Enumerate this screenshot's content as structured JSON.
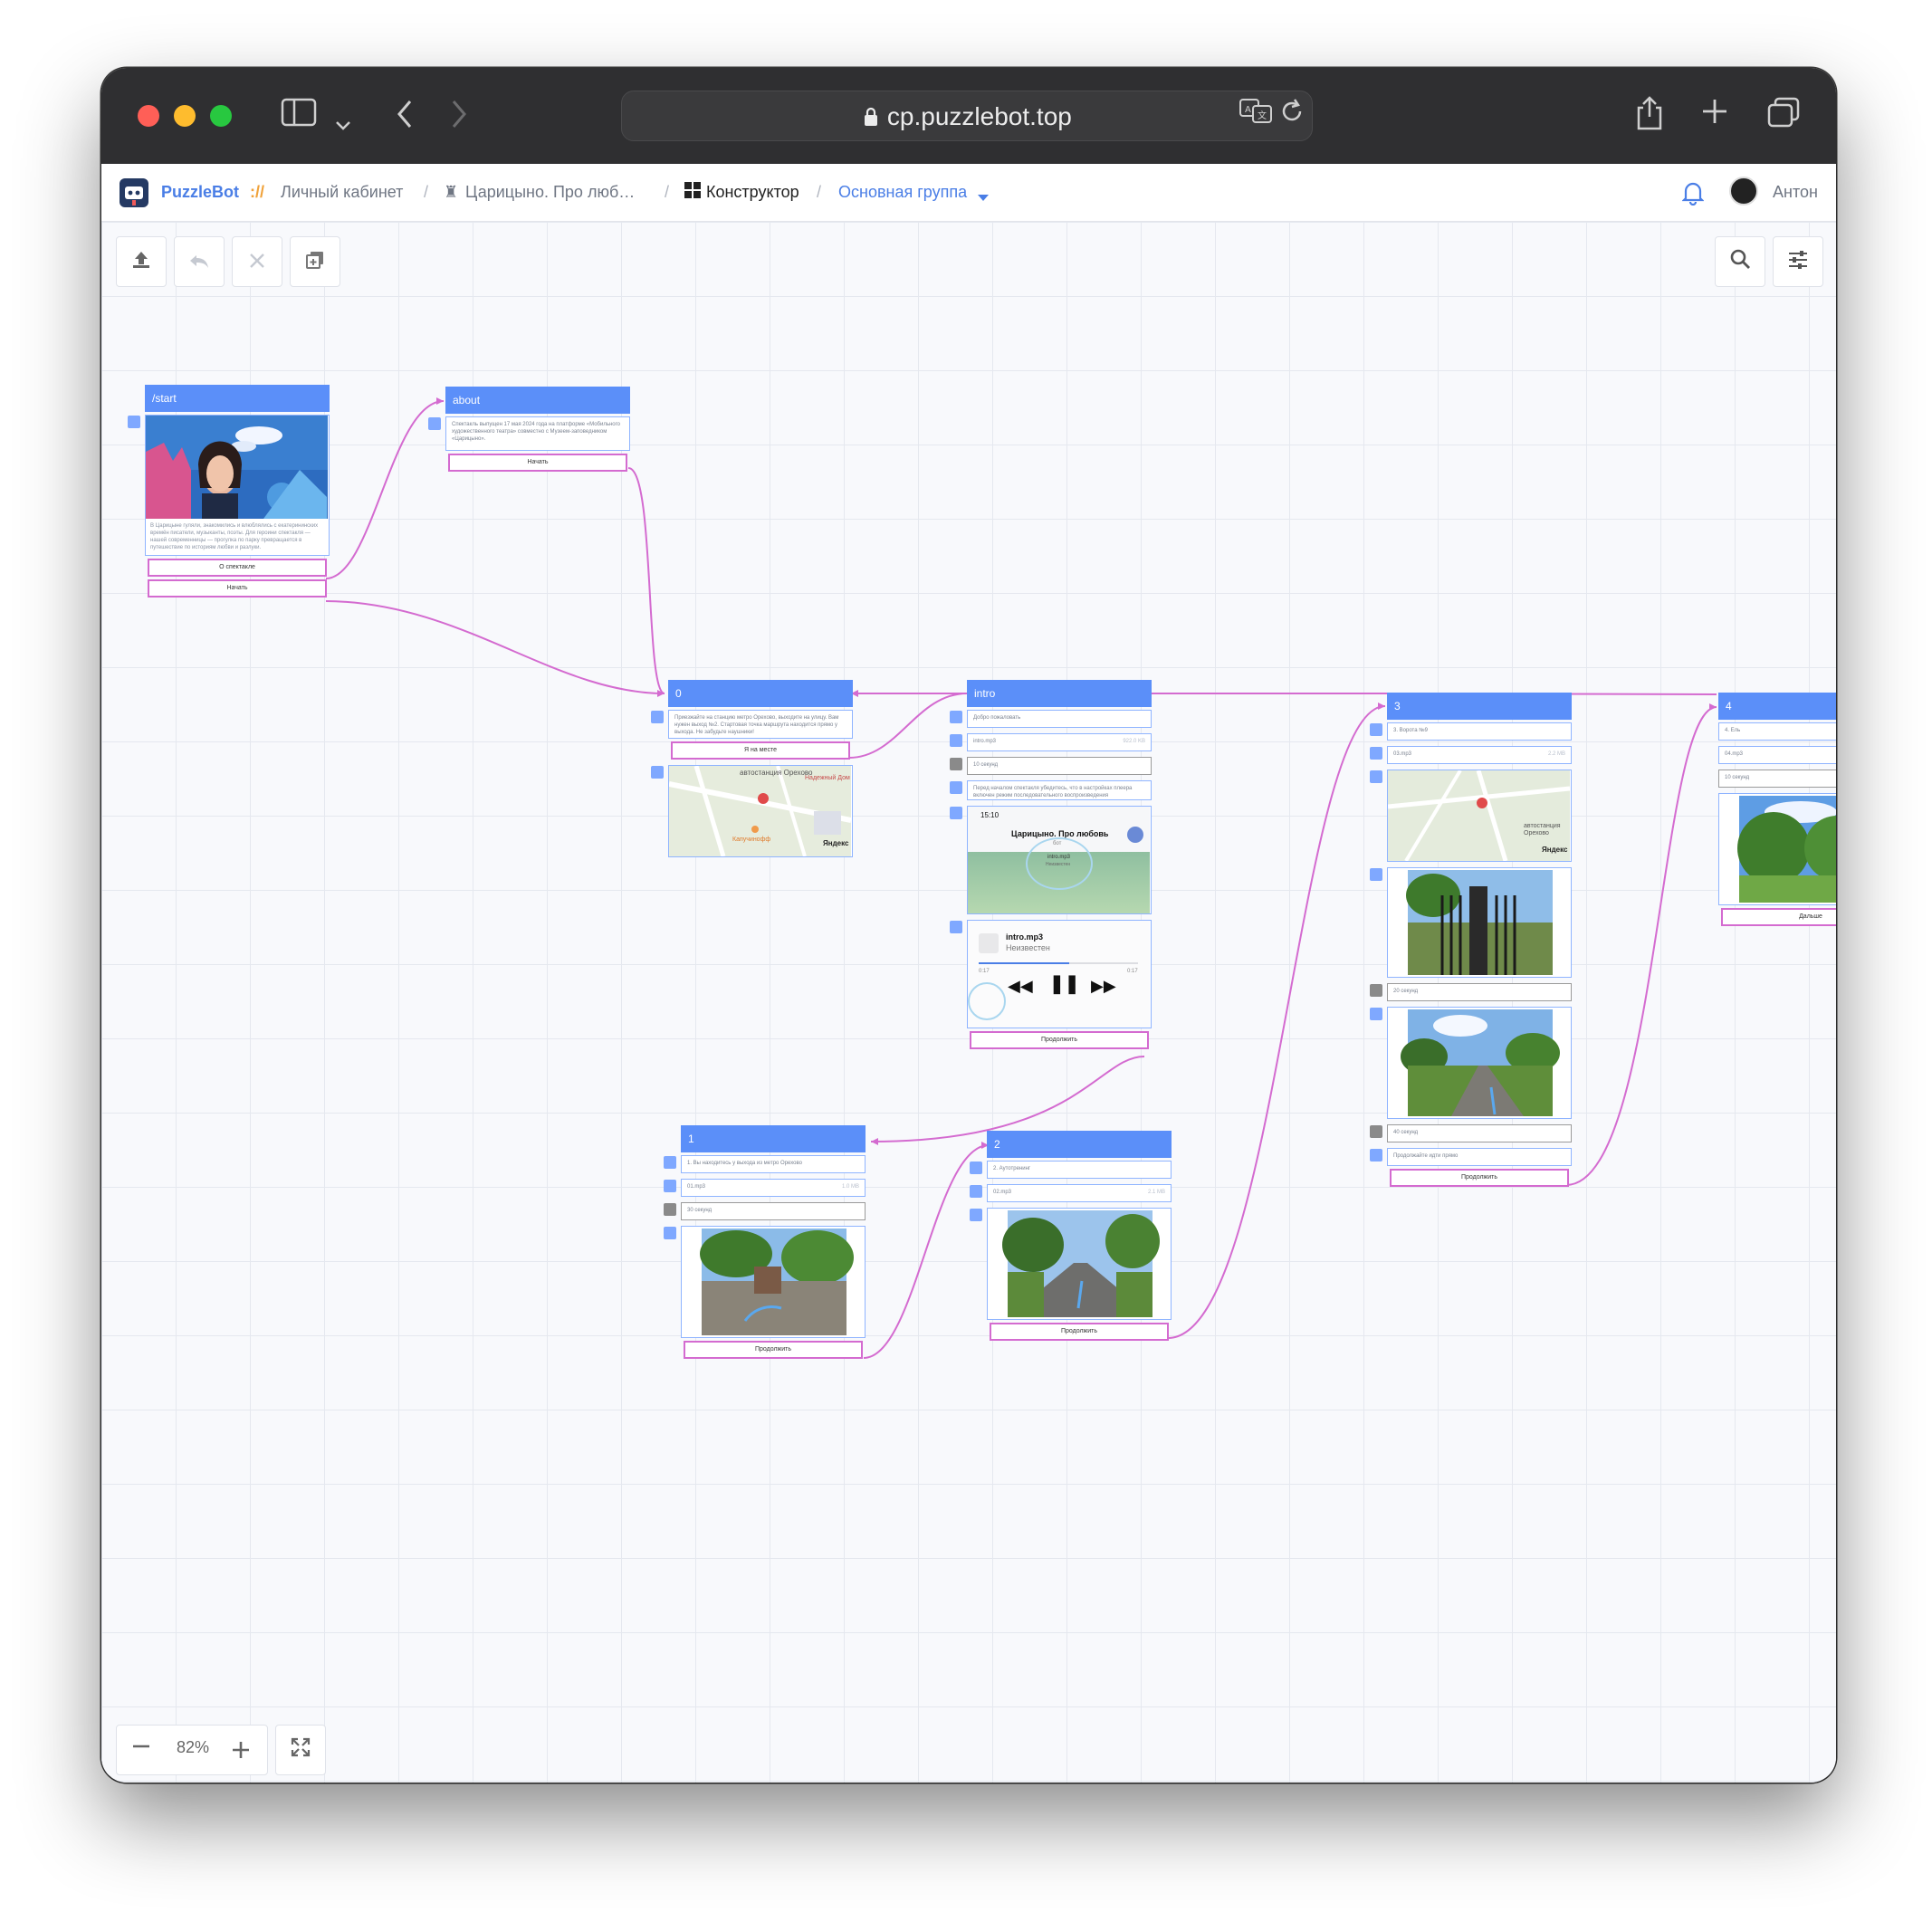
{
  "browser": {
    "url": "cp.puzzlebot.top"
  },
  "appbar": {
    "brand": "PuzzleBot",
    "brand_sep": "://",
    "crumb_1": "Личный кабинет",
    "crumb_2": "Царицыно. Про люб…",
    "crumb_3": "Конструктор",
    "group": "Основная группа",
    "user": "Антон"
  },
  "zoom": {
    "level": "82%"
  },
  "nodes": {
    "start": {
      "title": "/start",
      "text": "В Царицыне гуляли, знакомились и влюблялись с екатерининских времён писатели, музыканты, поэты. Для героини спектакля — нашей современницы — прогулка по парку превращается в путешествие по историям любви и разлуки.",
      "btn_about": "О спектакле",
      "btn_start": "Начать"
    },
    "about": {
      "title": "about",
      "text": "Спектакль выпущен 17 мая 2024 года на платформе «Мобильного художественного театра» совместно с Музеем-заповедником «Царицыно».",
      "btn_start": "Начать"
    },
    "n0": {
      "title": "0",
      "text": "Приезжайте на станцию метро Орехово, выходите на улицу. Вам нужен выход №2. Стартовая точка маршрута находится прямо у выхода. Не забудьте наушники!",
      "btn_here": "Я на месте",
      "map_label_1": "автостанция Орехово",
      "map_label_2": "Надежный Дом",
      "map_label_3": "Капучинофф",
      "map_brand": "Яндекс"
    },
    "intro": {
      "title": "intro",
      "text_1": "Добро пожаловать",
      "audio": "intro.mp3",
      "audio_size": "922.0 KB",
      "delay": "10 секунд",
      "text_2": "Перед началом спектакля убедитесь, что в настройках плеера включен режим последовательного воспроизведения",
      "shot1_time": "15:10",
      "shot1_title": "Царицыно. Про любовь",
      "shot1_sub": "бот",
      "shot1_track": "intro.mp3",
      "shot1_artist": "Неизвестен",
      "shot2_track": "intro.mp3",
      "shot2_artist": "Неизвестен",
      "shot2_t1": "0:17",
      "shot2_t2": "0:17",
      "btn_continue": "Продолжить"
    },
    "n1": {
      "title": "1",
      "text": "1. Вы находитесь у выхода из метро Орехово",
      "audio": "01.mp3",
      "audio_size": "1.0 MB",
      "delay": "30 секунд",
      "btn_continue": "Продолжить"
    },
    "n2": {
      "title": "2",
      "text": "2. Аутотренинг",
      "audio": "02.mp3",
      "audio_size": "2.1 MB",
      "btn_continue": "Продолжить"
    },
    "n3": {
      "title": "3",
      "text": "3. Ворота №9",
      "audio": "03.mp3",
      "audio_size": "2.2 MB",
      "map_label": "автостанция Орехово",
      "map_brand": "Яндекс",
      "delay_1": "20 секунд",
      "delay_2": "40 секунд",
      "text_2": "Продолжайте идти прямо",
      "btn_continue": "Продолжить"
    },
    "n4": {
      "title": "4",
      "text": "4. Ель",
      "audio": "04.mp3",
      "delay": "10 секунд",
      "btn_next": "Дальше"
    }
  },
  "colors": {
    "node_header": "#5b8ff9",
    "button_border": "#d46bd0",
    "connector": "#d46bd0",
    "titlebar": "#2f2f31"
  }
}
